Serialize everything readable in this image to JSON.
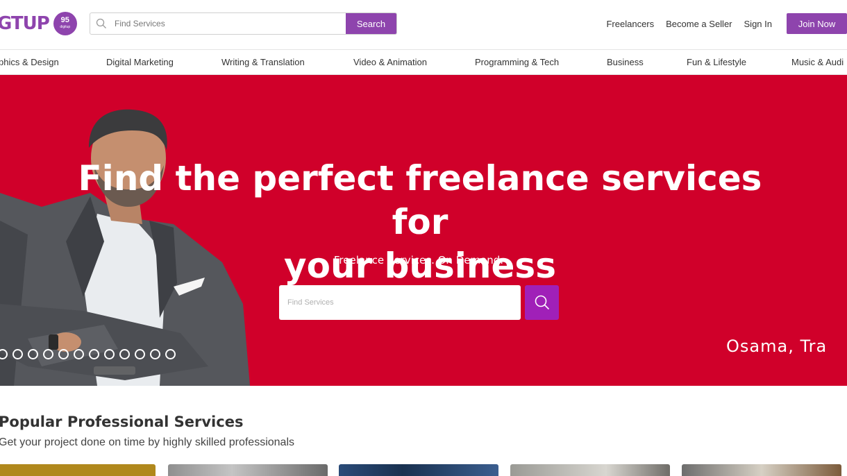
{
  "brand": {
    "logo_text": "GTUP",
    "badge_text": "95",
    "badge_small": "digitup",
    "accent_color": "#8e44ad",
    "hero_color": "#d0002a"
  },
  "header": {
    "search_placeholder": "Find Services",
    "search_button": "Search",
    "links": [
      "Freelancers",
      "Become a Seller",
      "Sign In"
    ],
    "join_button": "Join Now"
  },
  "categories": [
    "phics & Design",
    "Digital Marketing",
    "Writing & Translation",
    "Video & Animation",
    "Programming & Tech",
    "Business",
    "Fun & Lifestyle",
    "Music & Audi"
  ],
  "hero": {
    "title_line1": "Find the perfect freelance services for",
    "title_line2": "your business",
    "subtitle": "Freelance Services. On Demand.",
    "search_placeholder": "Find Services",
    "caption": "Osama, Tra",
    "slide_count": 12
  },
  "popular": {
    "title": "Popular Professional Services",
    "subtitle": "Get your project done on time by highly skilled professionals",
    "card_icons": [
      "card-image-1",
      "card-image-2",
      "card-image-3",
      "card-image-4",
      "card-image-5"
    ]
  }
}
